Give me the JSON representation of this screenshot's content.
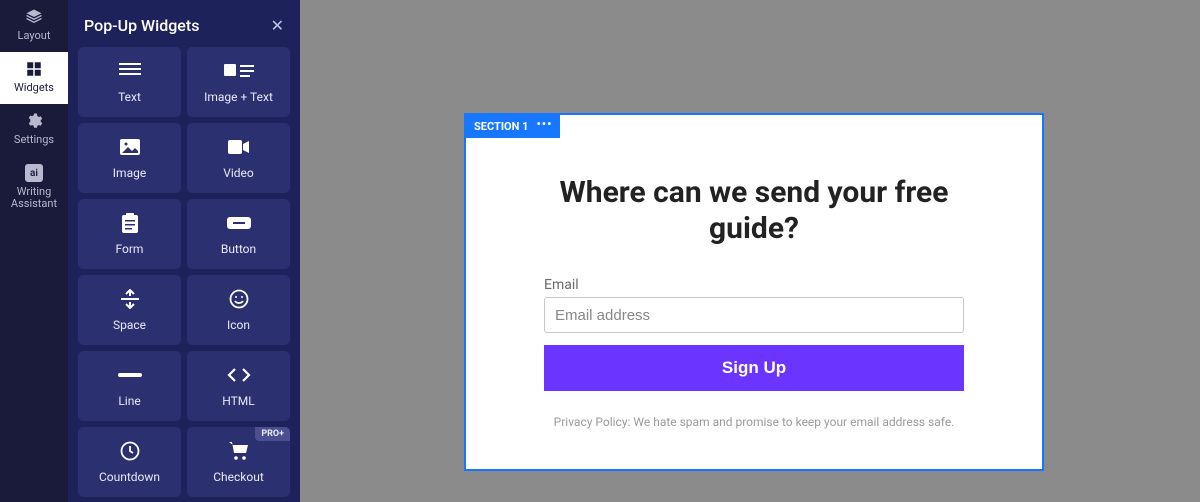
{
  "nav": {
    "items": [
      {
        "key": "layout",
        "label": "Layout"
      },
      {
        "key": "widgets",
        "label": "Widgets"
      },
      {
        "key": "settings",
        "label": "Settings"
      },
      {
        "key": "writing-assistant",
        "label": "Writing Assistant"
      }
    ]
  },
  "panel": {
    "title": "Pop-Up Widgets",
    "widgets": [
      {
        "key": "text",
        "label": "Text"
      },
      {
        "key": "image-text",
        "label": "Image + Text"
      },
      {
        "key": "image",
        "label": "Image"
      },
      {
        "key": "video",
        "label": "Video"
      },
      {
        "key": "form",
        "label": "Form"
      },
      {
        "key": "button",
        "label": "Button"
      },
      {
        "key": "space",
        "label": "Space"
      },
      {
        "key": "icon",
        "label": "Icon"
      },
      {
        "key": "line",
        "label": "Line"
      },
      {
        "key": "html",
        "label": "HTML"
      },
      {
        "key": "countdown",
        "label": "Countdown"
      },
      {
        "key": "checkout",
        "label": "Checkout",
        "badge": "PRO+"
      }
    ]
  },
  "canvas": {
    "section_label": "SECTION 1",
    "popup": {
      "title": "Where can we send your free guide?",
      "email_label": "Email",
      "email_placeholder": "Email address",
      "button_label": "Sign Up",
      "privacy_text": "Privacy Policy: We hate spam and promise to keep your email address safe."
    }
  },
  "colors": {
    "section_blue": "#1877ff",
    "button_purple": "#6b34ff",
    "panel_bg": "#1e225a",
    "card_bg": "#2b3070",
    "nav_bg": "#1a1a3a"
  }
}
